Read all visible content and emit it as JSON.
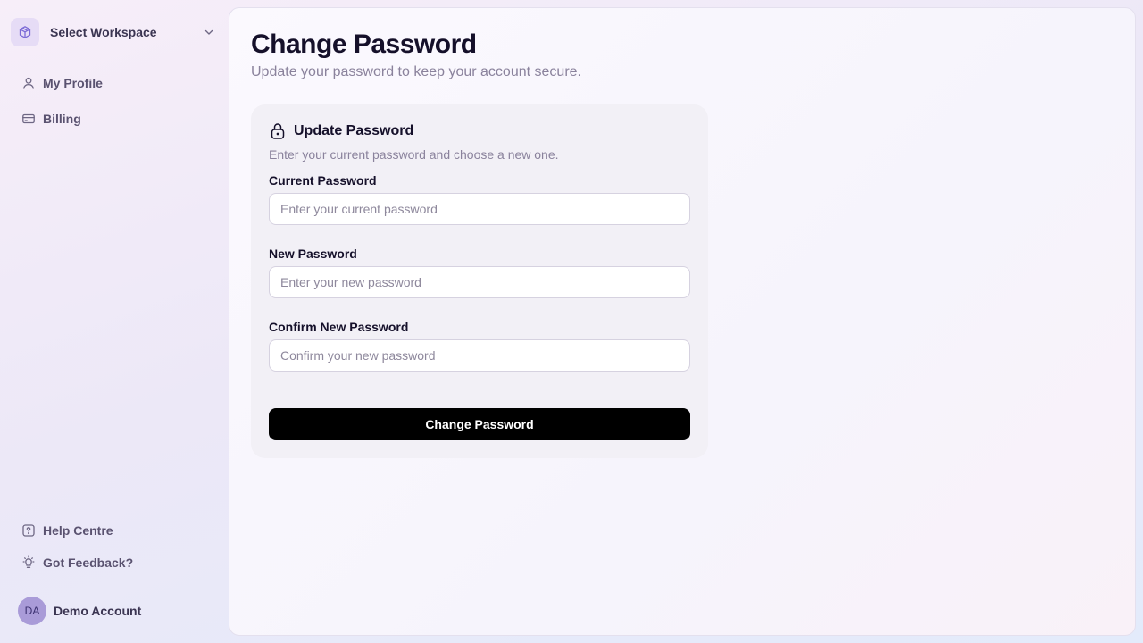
{
  "sidebar": {
    "workspace": {
      "label": "Select Workspace",
      "icon": "cube-icon"
    },
    "nav": [
      {
        "label": "My Profile",
        "icon": "user-icon"
      },
      {
        "label": "Billing",
        "icon": "credit-card-icon"
      }
    ],
    "footer": [
      {
        "label": "Help Centre",
        "icon": "help-icon"
      },
      {
        "label": "Got Feedback?",
        "icon": "lightbulb-icon"
      }
    ],
    "account": {
      "initials": "DA",
      "name": "Demo Account"
    }
  },
  "main": {
    "title": "Change Password",
    "subtitle": "Update your password to keep your account secure.",
    "card": {
      "title": "Update Password",
      "description": "Enter your current password and choose a new one.",
      "fields": [
        {
          "label": "Current Password",
          "placeholder": "Enter your current password",
          "value": ""
        },
        {
          "label": "New Password",
          "placeholder": "Enter your new password",
          "value": ""
        },
        {
          "label": "Confirm New Password",
          "placeholder": "Confirm your new password",
          "value": ""
        }
      ],
      "submit_label": "Change Password"
    }
  },
  "colors": {
    "accent": "#7c6bd6",
    "button_bg": "#000000",
    "avatar_bg": "#a99bd8"
  }
}
